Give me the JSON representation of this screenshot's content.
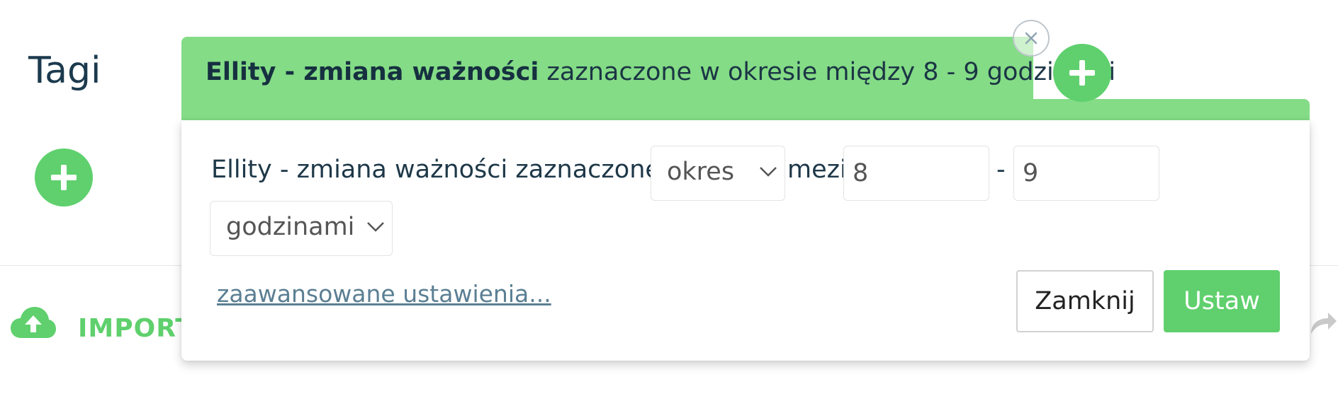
{
  "background": {
    "title": "Tagi",
    "import_label": "IMPORT",
    "icons": {
      "add": "plus-icon",
      "cloud": "cloud-upload-icon",
      "share": "share-arrow-icon"
    }
  },
  "popover": {
    "header": {
      "title_strong": "Ellity - zmiana ważności",
      "title_rest": " zaznaczone w okresie między 8 - 9 godzinami"
    },
    "form": {
      "sentence": "Ellity - zmiana ważności zaznaczone w",
      "period_select": "okres",
      "word_between": "mezi",
      "from_value": "8",
      "dash": "-",
      "to_value": "9",
      "unit_select": "godzinami"
    },
    "advanced_link": "zaawansowane ustawienia...",
    "buttons": {
      "close": "Zamknij",
      "set": "Ustaw"
    }
  },
  "colors": {
    "accent": "#5fd06d",
    "header_bg": "#84dc86",
    "text_dark": "#1e3848",
    "link": "#5b7f93"
  }
}
